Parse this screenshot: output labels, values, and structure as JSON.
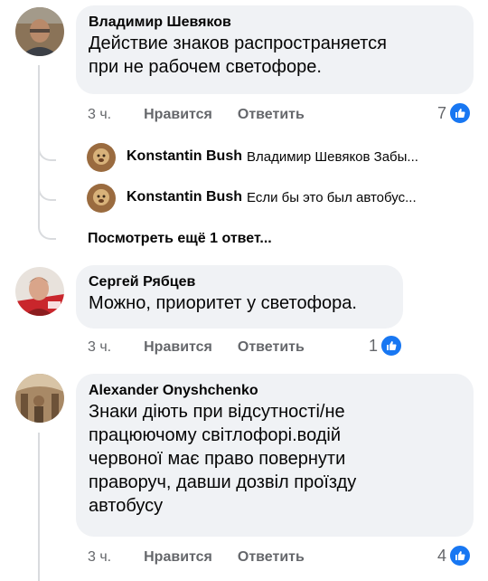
{
  "comments": [
    {
      "author": "Владимир Шевяков",
      "text_lines": [
        "Действие знаков распространяется",
        "при не рабочем светофоре."
      ],
      "time": "3 ч.",
      "like_label": "Нравится",
      "reply_label": "Ответить",
      "reaction_count": "7",
      "avatar_colors": {
        "skin": "#b98a6a",
        "bg": "#8a7358",
        "shirt": "#3b3f46"
      }
    },
    {
      "author": "Сергей Рябцев",
      "text_lines": [
        "Можно, приоритет у светофора."
      ],
      "time": "3 ч.",
      "like_label": "Нравится",
      "reply_label": "Ответить",
      "reaction_count": "1",
      "avatar_colors": {
        "skin": "#d9a58a",
        "bg": "#c9262c",
        "shirt": "#8c1d1f"
      }
    },
    {
      "author": "Alexander Onyshchenko",
      "text_lines": [
        "Знаки діють при відсутності/не",
        "працюючому світлофорі.водій",
        "червоної має право повернути",
        "праворуч, давши дозвіл проїзду",
        "автобусу"
      ],
      "time": "3 ч.",
      "like_label": "Нравится",
      "reply_label": "Ответить",
      "reaction_count": "4",
      "avatar_colors": {
        "skin": "#8c6a4a",
        "bg": "#a88966",
        "shirt": "#5b4530"
      }
    }
  ],
  "replies": [
    {
      "author": "Konstantin Bush",
      "preview": "Владимир Шевяков Забы..."
    },
    {
      "author": "Konstantin Bush",
      "preview": "Если бы это был автобус..."
    }
  ],
  "more_replies_label": "Посмотреть ещё 1 ответ...",
  "colors": {
    "bubble": "#f0f2f5",
    "meta": "#65676b",
    "like_blue": "#1877f2",
    "thread": "#d9dbde"
  },
  "icons": {
    "like": "thumbs-up-icon"
  }
}
